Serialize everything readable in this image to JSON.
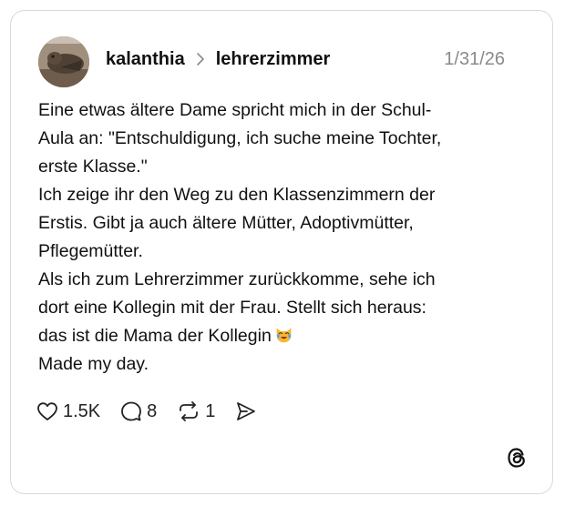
{
  "post": {
    "username": "kalanthia",
    "community": "lehrerzimmer",
    "date": "1/31/26",
    "lines": [
      "Eine etwas ältere Dame spricht mich in der Schul-",
      "Aula an: \"Entschuldigung, ich suche meine Tochter,",
      "erste Klasse.\"",
      "Ich zeige ihr den Weg zu den Klassenzimmern der",
      "Erstis. Gibt ja auch ältere Mütter, Adoptivmütter,",
      "Pflegemütter.",
      "Als ich zum Lehrerzimmer zurückkomme, sehe ich",
      "dort eine Kollegin mit der Frau. Stellt sich heraus:",
      "das ist die Mama der Kollegin",
      "Made my day."
    ],
    "emoji": "laughing-cat-with-tears"
  },
  "actions": {
    "likes": "1.5K",
    "replies": "8",
    "reposts": "1"
  },
  "icons": {
    "like": "heart-icon",
    "reply": "comment-icon",
    "repost": "repost-icon",
    "share": "send-icon",
    "brand": "threads-logo"
  },
  "colors": {
    "text": "#111111",
    "muted": "#8a8a8a",
    "border": "#d9d9d9"
  }
}
